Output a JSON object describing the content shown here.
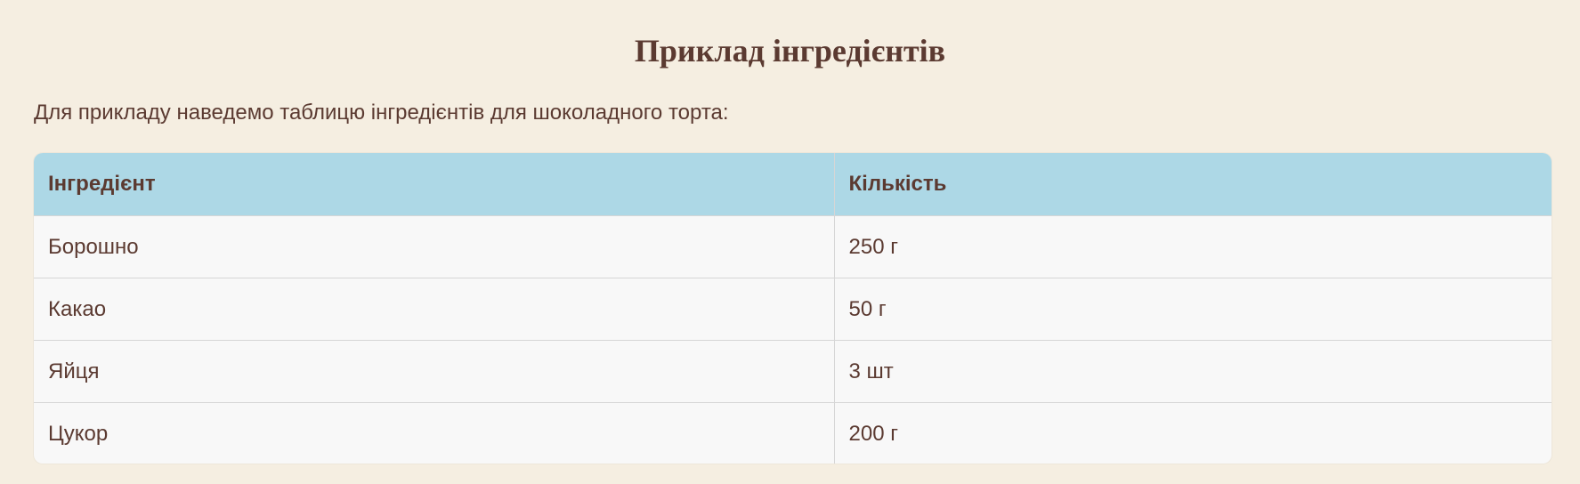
{
  "heading": "Приклад інгредієнтів",
  "intro": "Для прикладу наведемо таблицю інгредієнтів для шоколадного торта:",
  "table": {
    "headers": [
      "Інгредієнт",
      "Кількість"
    ],
    "rows": [
      [
        "Борошно",
        "250 г"
      ],
      [
        "Какао",
        "50 г"
      ],
      [
        "Яйця",
        "3 шт"
      ],
      [
        "Цукор",
        "200 г"
      ]
    ]
  },
  "colors": {
    "background": "#f5eee1",
    "text": "#5b3a31",
    "header_background": "#add8e6",
    "row_background": "#f8f8f8"
  }
}
